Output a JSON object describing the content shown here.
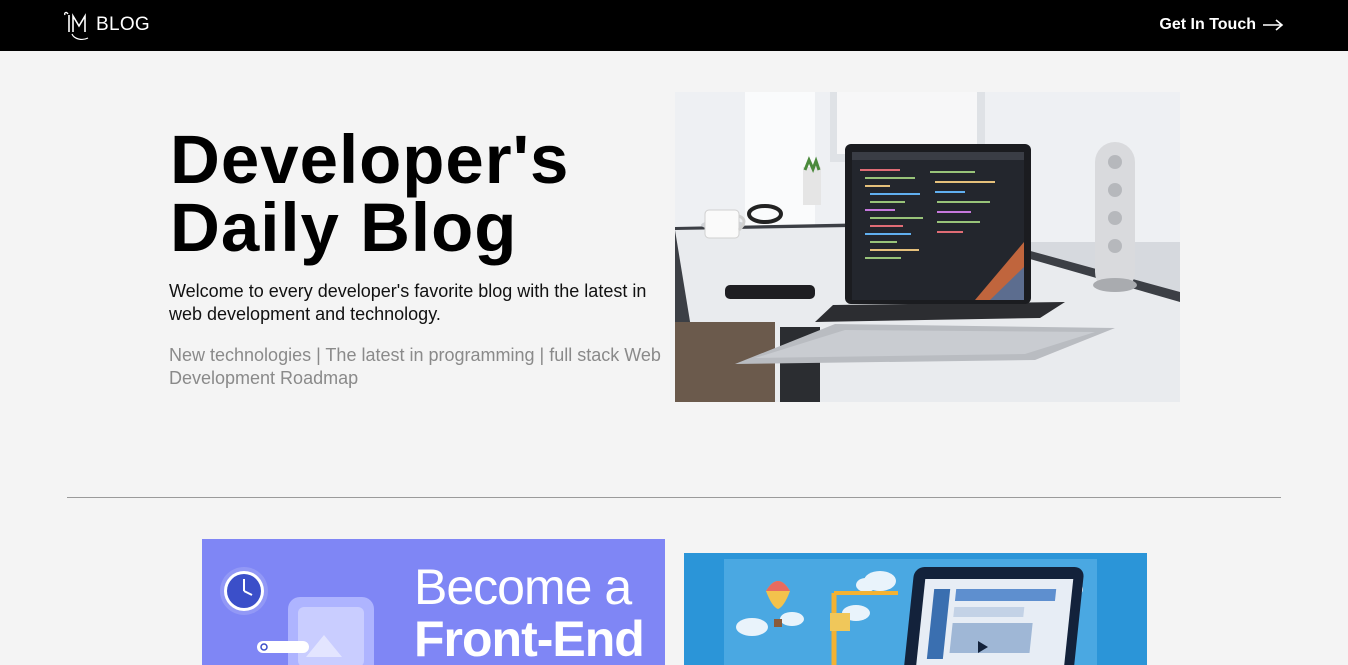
{
  "header": {
    "logo_text": "BLOG",
    "logo_mark": "IM",
    "cta_label": "Get In Touch",
    "cta_icon": "arrow-right-icon"
  },
  "hero": {
    "title_line1": "Developer's",
    "title_line2": "Daily Blog",
    "lead": "Welcome to every developer's favorite blog with the latest in web development and technology.",
    "tags": "New technologies | The latest in programming | full stack Web Development Roadmap"
  },
  "posts": [
    {
      "title_line1": "Become a",
      "title_line2": "Front-End",
      "theme_color": "#7f86f5"
    },
    {
      "theme_color": "#2b95d8"
    }
  ]
}
